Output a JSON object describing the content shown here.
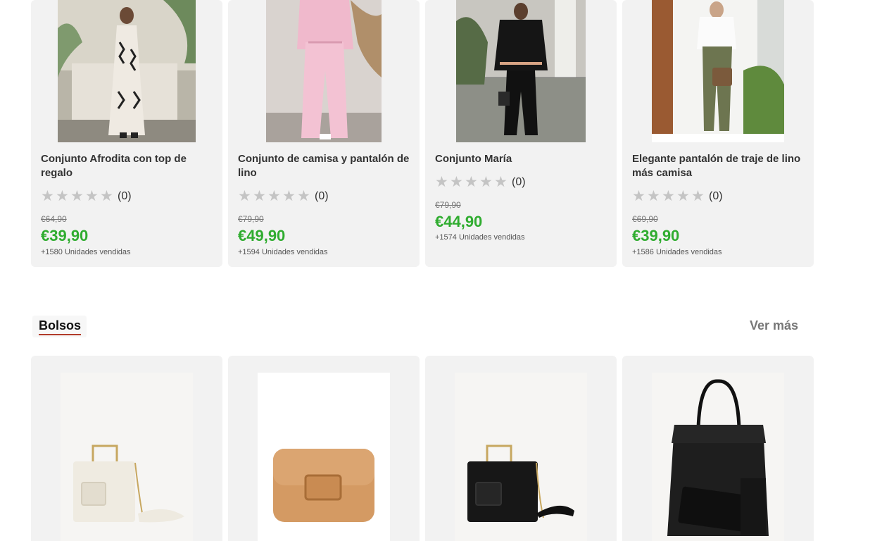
{
  "products": [
    {
      "title": "Conjunto Afrodita con top de regalo",
      "rating_count": "(0)",
      "old_price": "€64,90",
      "price": "€39,90",
      "sold": "+1580 Unidades vendidas"
    },
    {
      "title": "Conjunto de camisa y pantalón de lino",
      "rating_count": "(0)",
      "old_price": "€79,90",
      "price": "€49,90",
      "sold": "+1594 Unidades vendidas"
    },
    {
      "title": "Conjunto María",
      "rating_count": "(0)",
      "old_price": "€79,90",
      "price": "€44,90",
      "sold": "+1574 Unidades vendidas"
    },
    {
      "title": "Elegante pantalón de traje de lino más camisa",
      "rating_count": "(0)",
      "old_price": "€69,90",
      "price": "€39,90",
      "sold": "+1586 Unidades vendidas"
    }
  ],
  "rating_stars": 0,
  "section": {
    "title": "Bolsos",
    "see_more": "Ver más"
  },
  "colors": {
    "price": "#2fac2f",
    "star_empty": "#c4c4c4",
    "tab_underline": "#b13b2a",
    "card_bg": "#f2f2f2"
  },
  "icons": {
    "star": "star-icon"
  }
}
